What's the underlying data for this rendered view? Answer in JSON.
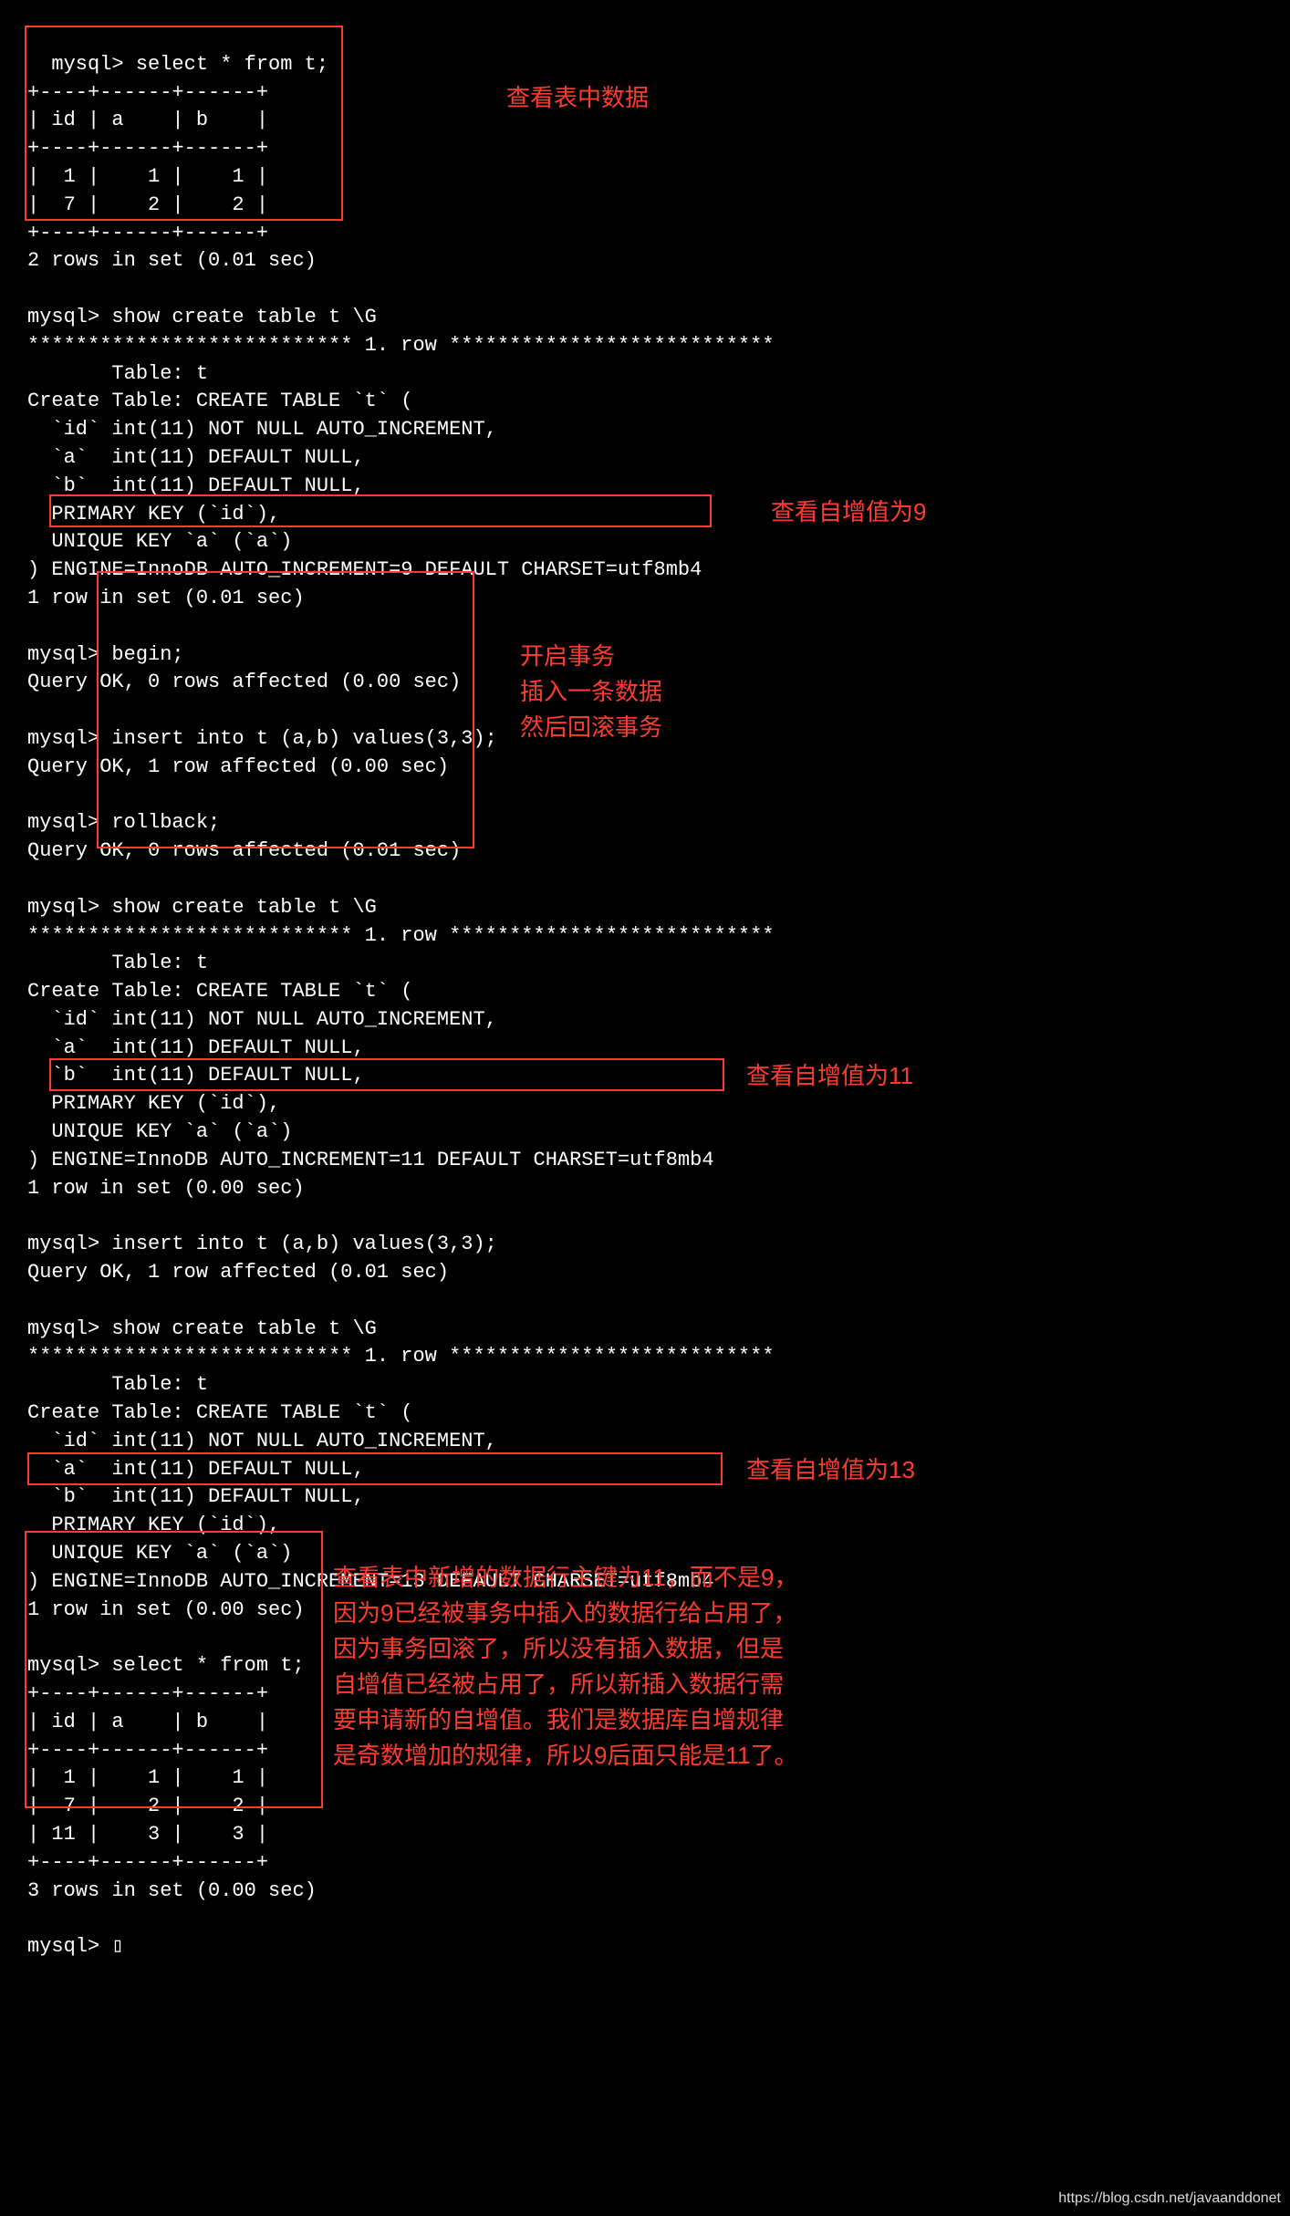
{
  "terminal": {
    "block1": "mysql> select * from t;\n+----+------+------+\n| id | a    | b    |\n+----+------+------+\n|  1 |    1 |    1 |\n|  7 |    2 |    2 |\n+----+------+------+\n2 rows in set (0.01 sec)\n\nmysql> show create table t \\G\n*************************** 1. row ***************************\n       Table: t\nCreate Table: CREATE TABLE `t` (\n  `id` int(11) NOT NULL AUTO_INCREMENT,\n  `a`  int(11) DEFAULT NULL,\n  `b`  int(11) DEFAULT NULL,\n  PRIMARY KEY (`id`),\n  UNIQUE KEY `a` (`a`)\n) ENGINE=InnoDB AUTO_INCREMENT=9 DEFAULT CHARSET=utf8mb4\n1 row in set (0.01 sec)\n\nmysql> begin;\nQuery OK, 0 rows affected (0.00 sec)\n\nmysql> insert into t (a,b) values(3,3);\nQuery OK, 1 row affected (0.00 sec)\n\nmysql> rollback;\nQuery OK, 0 rows affected (0.01 sec)\n\nmysql> show create table t \\G\n*************************** 1. row ***************************\n       Table: t\nCreate Table: CREATE TABLE `t` (\n  `id` int(11) NOT NULL AUTO_INCREMENT,\n  `a`  int(11) DEFAULT NULL,\n  `b`  int(11) DEFAULT NULL,\n  PRIMARY KEY (`id`),\n  UNIQUE KEY `a` (`a`)\n) ENGINE=InnoDB AUTO_INCREMENT=11 DEFAULT CHARSET=utf8mb4\n1 row in set (0.00 sec)\n\nmysql> insert into t (a,b) values(3,3);\nQuery OK, 1 row affected (0.01 sec)\n\nmysql> show create table t \\G\n*************************** 1. row ***************************\n       Table: t\nCreate Table: CREATE TABLE `t` (\n  `id` int(11) NOT NULL AUTO_INCREMENT,\n  `a`  int(11) DEFAULT NULL,\n  `b`  int(11) DEFAULT NULL,\n  PRIMARY KEY (`id`),\n  UNIQUE KEY `a` (`a`)\n) ENGINE=InnoDB AUTO_INCREMENT=13 DEFAULT CHARSET=utf8mb4\n1 row in set (0.00 sec)\n\nmysql> select * from t;\n+----+------+------+\n| id | a    | b    |\n+----+------+------+\n|  1 |    1 |    1 |\n|  7 |    2 |    2 |\n| 11 |    3 |    3 |\n+----+------+------+\n3 rows in set (0.00 sec)\n\nmysql> "
  },
  "annotations": {
    "a1": "查看表中数据",
    "a2": "查看自增值为9",
    "a3_l1": "开启事务",
    "a3_l2": "插入一条数据",
    "a3_l3": "然后回滚事务",
    "a4": "查看自增值为11",
    "a5": "查看自增值为13",
    "a6_l1": "查看表中新增的数据行主键为11，而不是9，",
    "a6_l2": "因为9已经被事务中插入的数据行给占用了，",
    "a6_l3": "因为事务回滚了，所以没有插入数据，但是",
    "a6_l4": "自增值已经被占用了，所以新插入数据行需",
    "a6_l5": "要申请新的自增值。我们是数据库自增规律",
    "a6_l6": "是奇数增加的规律，所以9后面只能是11了。"
  },
  "cursor": "▯",
  "watermark": "https://blog.csdn.net/javaanddonet"
}
